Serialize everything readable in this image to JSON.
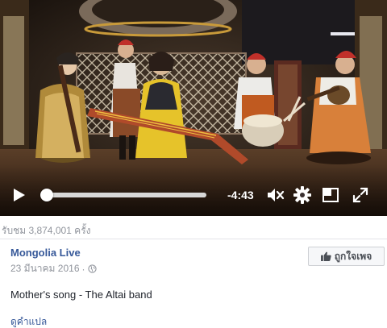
{
  "video": {
    "time_remaining": "-4:43",
    "progress": 0.0,
    "controls": {
      "play": "play-icon",
      "mute": "volume-muted-icon",
      "settings": "gear-icon",
      "popout": "picture-in-picture-icon",
      "fullscreen": "fullscreen-icon"
    }
  },
  "view_count": "รับชม 3,874,001 ครั้ง",
  "post": {
    "page_name": "Mongolia Live",
    "date": "23 มีนาคม 2016",
    "separator": "·",
    "privacy_icon": "globe-icon",
    "like_page_label": "ถูกใจเพจ",
    "text": "Mother's song - The Altai band",
    "translate_label": "ดูคำแปล"
  },
  "colors": {
    "link": "#365899",
    "meta": "#90949c",
    "text": "#1d2129",
    "button_bg": "#f6f7f9",
    "button_border": "#ced0d4"
  }
}
